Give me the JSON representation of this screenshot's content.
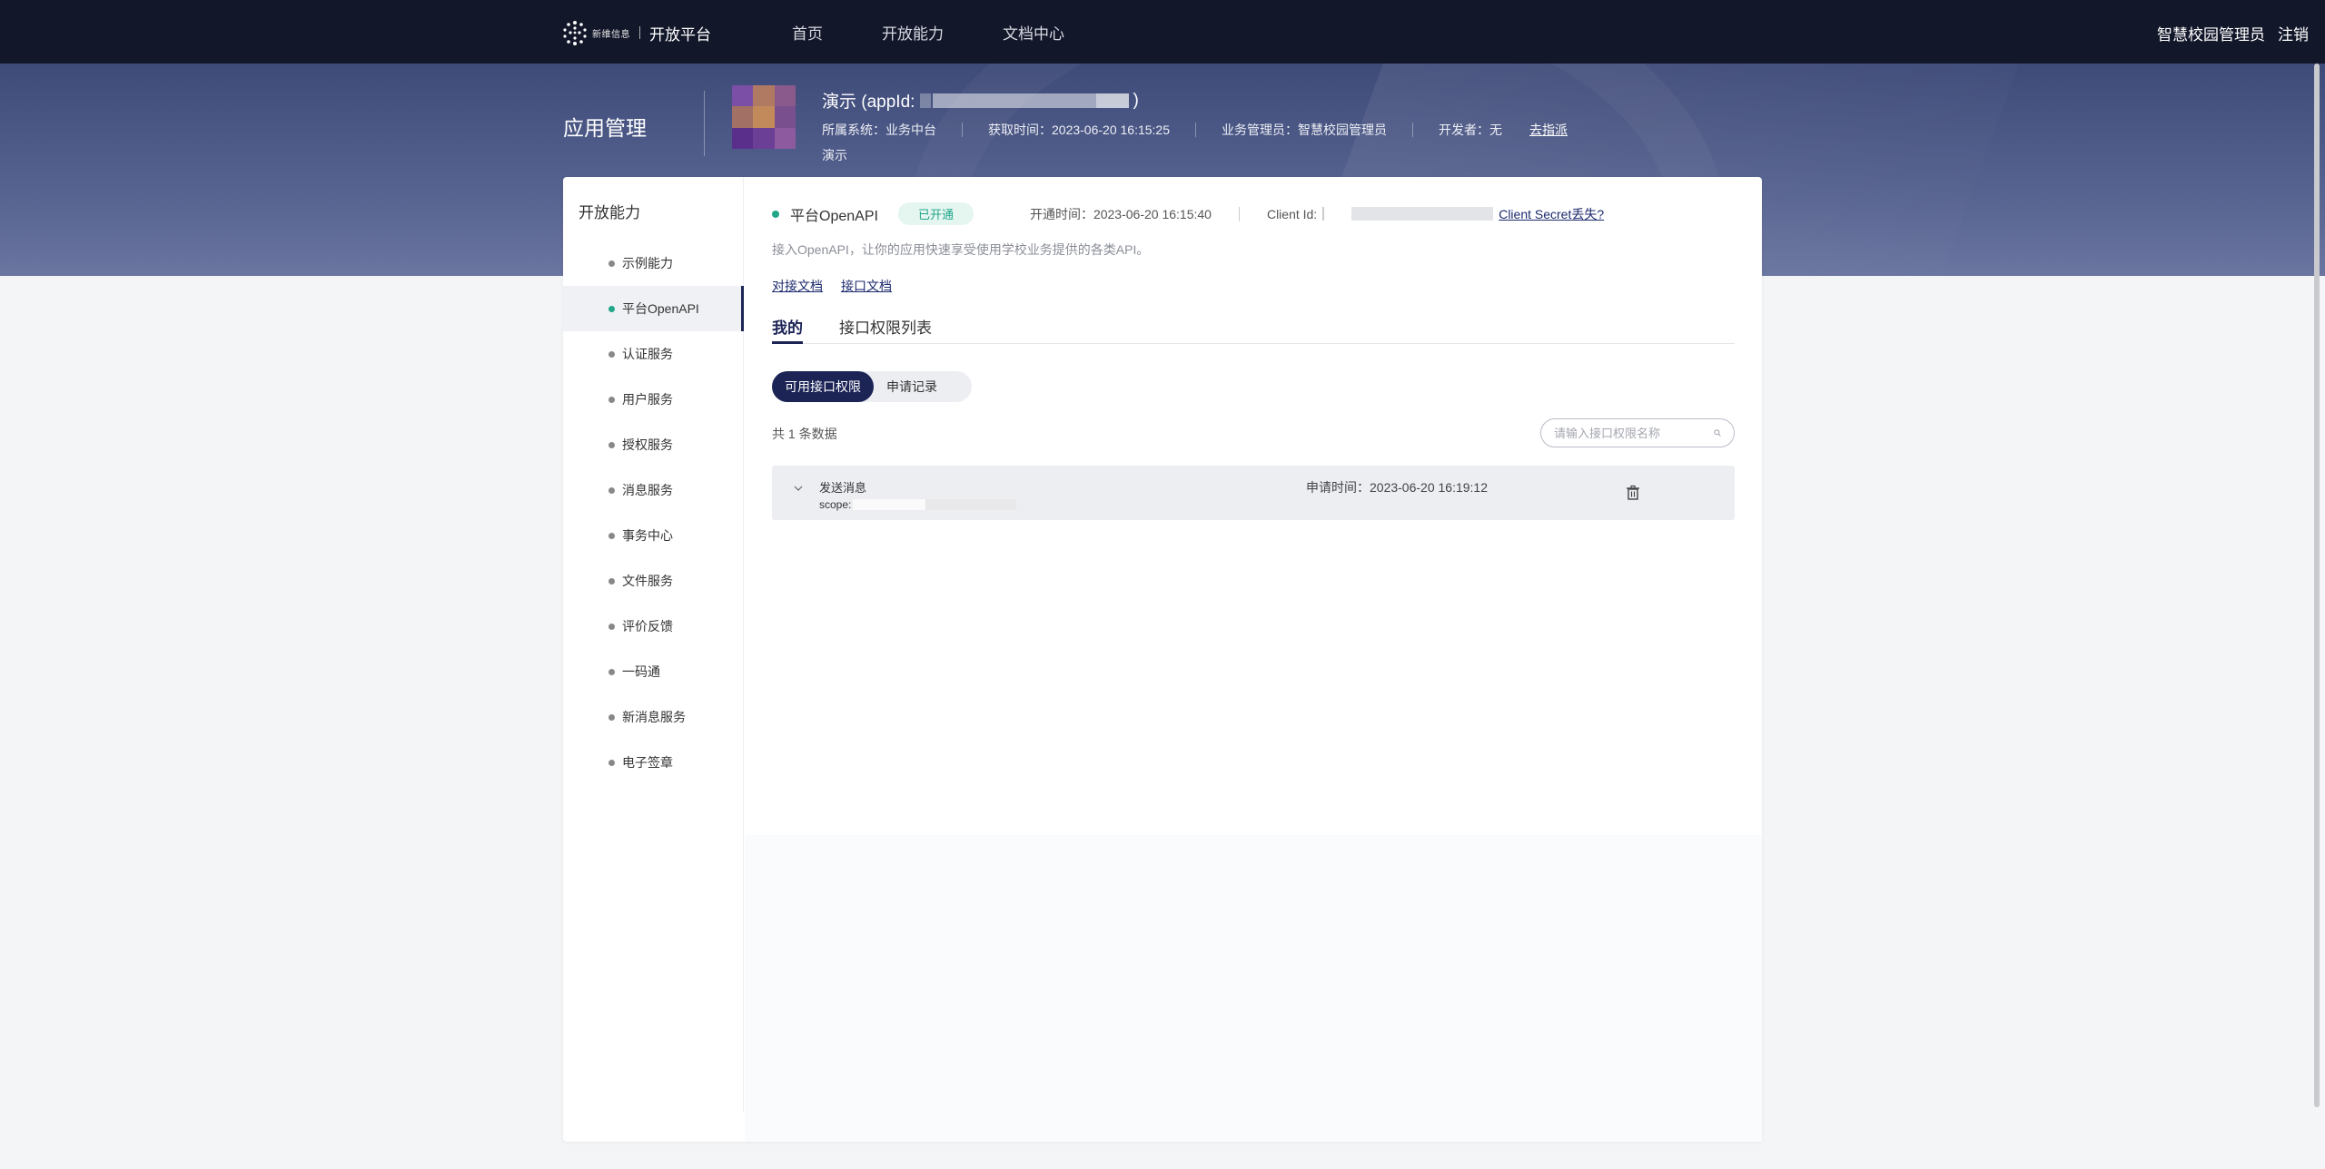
{
  "header": {
    "logo_text": "新维信息",
    "logo_title": "开放平台",
    "nav": [
      "首页",
      "开放能力",
      "文档中心"
    ],
    "user": "智慧校园管理员",
    "logout": "注销"
  },
  "banner": {
    "title": "应用管理",
    "app_name": "演示 (appId:",
    "app_name_close": ")",
    "system_label": "所属系统：业务中台",
    "obtain_time": "获取时间：2023-06-20 16:15:25",
    "manager": "业务管理员：智慧校园管理员",
    "developer": "开发者：无",
    "assign_link": "去指派",
    "description": "演示"
  },
  "sidebar": {
    "title": "开放能力",
    "items": [
      {
        "label": "示例能力"
      },
      {
        "label": "平台OpenAPI"
      },
      {
        "label": "认证服务"
      },
      {
        "label": "用户服务"
      },
      {
        "label": "授权服务"
      },
      {
        "label": "消息服务"
      },
      {
        "label": "事务中心"
      },
      {
        "label": "文件服务"
      },
      {
        "label": "评价反馈"
      },
      {
        "label": "一码通"
      },
      {
        "label": "新消息服务"
      },
      {
        "label": "电子签章"
      }
    ],
    "active_index": 1
  },
  "main": {
    "api_name": "平台OpenAPI",
    "status": "已开通",
    "open_time": "开通时间：2023-06-20 16:15:40",
    "client_id_label": "Client Id:",
    "secret_lost": "Client Secret丢失?",
    "description": "接入OpenAPI，让你的应用快速享受使用学校业务提供的各类API。",
    "links": [
      "对接文档",
      "接口文档"
    ],
    "tabs": [
      "我的",
      "接口权限列表"
    ],
    "segments": [
      "可用接口权限",
      "申请记录"
    ],
    "count_text": "共 1 条数据",
    "search_placeholder": "请输入接口权限名称",
    "rows": [
      {
        "title": "发送消息",
        "scope_label": "scope:",
        "apply_time": "申请时间：2023-06-20 16:19:12"
      }
    ]
  },
  "colors": {
    "nav_bg": "#13172a",
    "accent": "#1c2456",
    "success": "#21a68a"
  }
}
